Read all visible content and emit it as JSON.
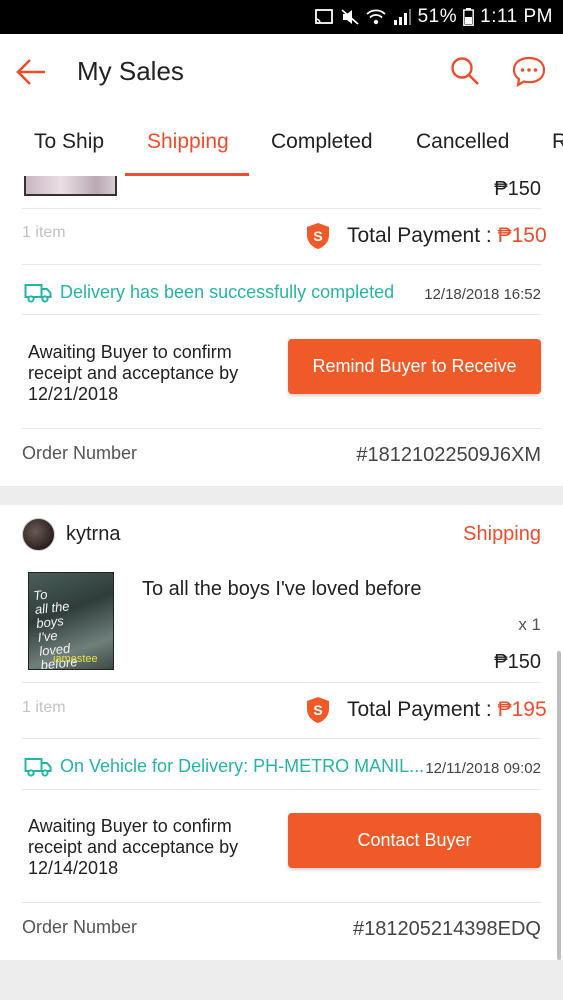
{
  "status_bar": {
    "battery": "51%",
    "time": "1:11 PM"
  },
  "header": {
    "title": "My Sales"
  },
  "tabs": [
    {
      "label": "To Ship"
    },
    {
      "label": "Shipping"
    },
    {
      "label": "Completed"
    },
    {
      "label": "Cancelled"
    },
    {
      "label": "R"
    }
  ],
  "orders": [
    {
      "price": "₱150",
      "items_count": "1 item",
      "total_label": "Total Payment : ",
      "total_value": "₱150",
      "delivery_text": "Delivery has been successfully completed",
      "delivery_date": "12/18/2018 16:52",
      "await_text": "Awaiting Buyer to confirm receipt and acceptance by 12/21/2018",
      "action_label": "Remind Buyer to Receive",
      "order_number_label": "Order Number",
      "order_number": "#18121022509J6XM"
    },
    {
      "buyer": "kytrna",
      "status": "Shipping",
      "product_name": "To all the boys I've loved before",
      "quantity": "x 1",
      "price": "₱150",
      "items_count": "1 item",
      "total_label": "Total Payment : ",
      "total_value": "₱195",
      "delivery_text": "On Vehicle for Delivery: PH-METRO MANIL...",
      "delivery_date": "12/11/2018 09:02",
      "await_text": "Awaiting Buyer to confirm receipt and acceptance by 12/14/2018",
      "action_label": "Contact Buyer",
      "order_number_label": "Order Number",
      "order_number": "#181205214398EDQ"
    }
  ],
  "colors": {
    "accent": "#ee4d2d",
    "delivery": "#26b5a5",
    "button": "#f05a29"
  },
  "icons": [
    "back-arrow-icon",
    "search-icon",
    "chat-icon",
    "shield-icon",
    "truck-icon"
  ]
}
